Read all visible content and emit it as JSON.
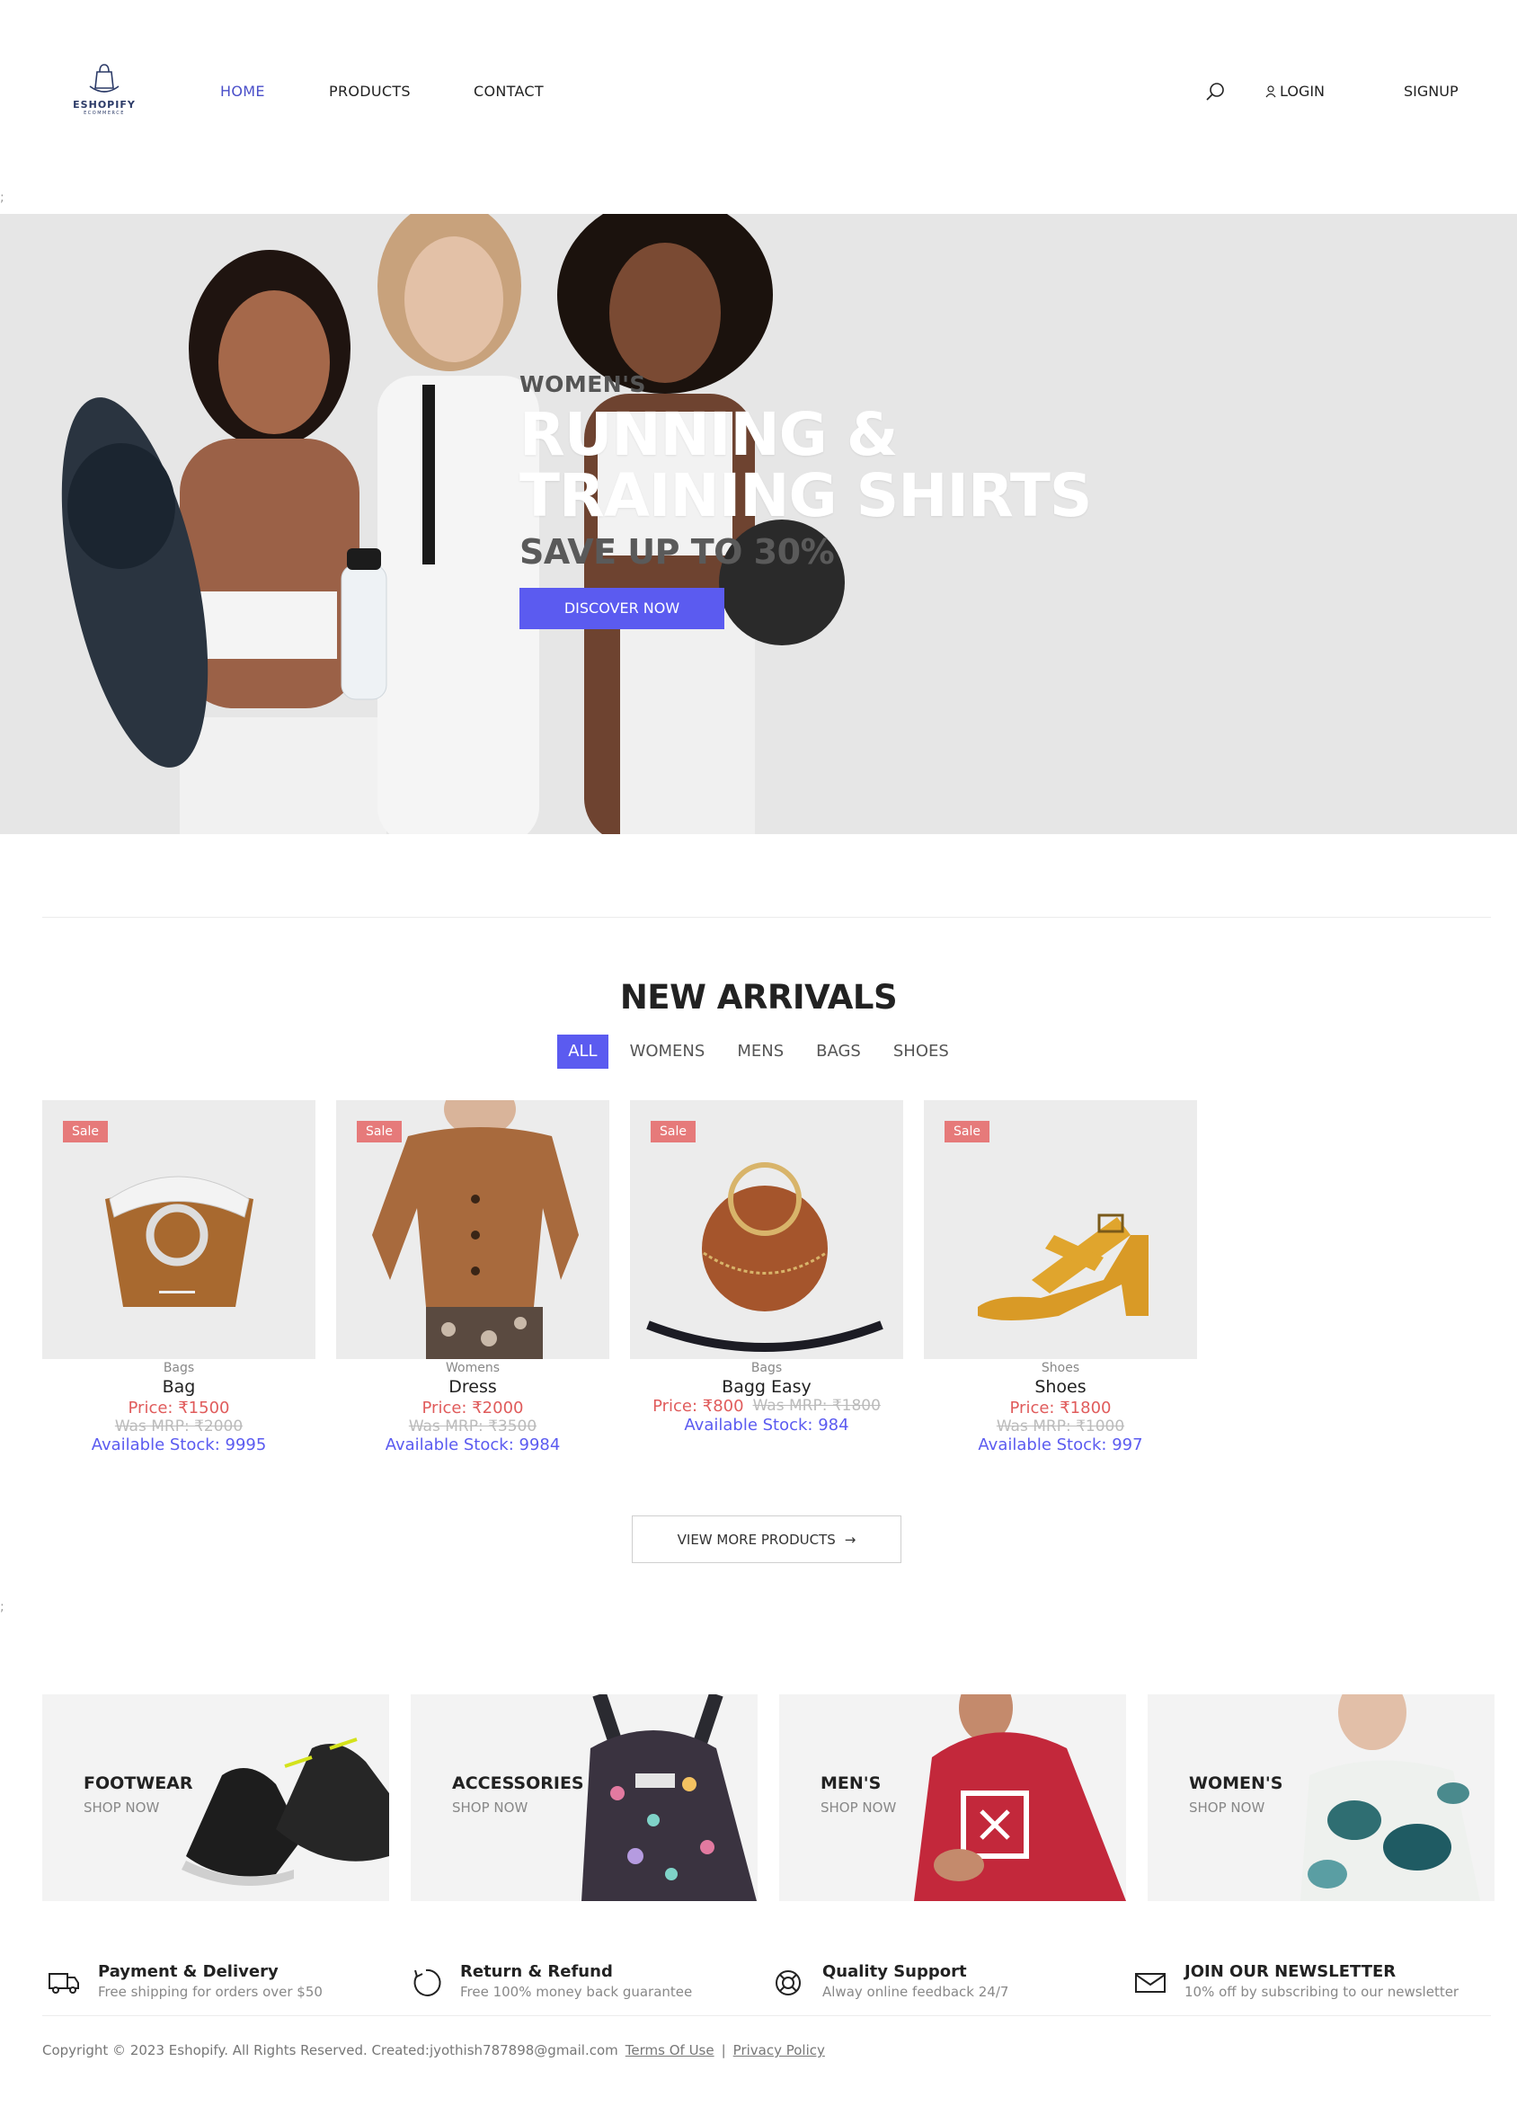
{
  "brand": {
    "name": "ESHOPIFY",
    "tagline": "ECOMMERCE"
  },
  "nav": {
    "links": [
      {
        "label": "HOME",
        "active": true
      },
      {
        "label": "PRODUCTS",
        "active": false
      },
      {
        "label": "CONTACT",
        "active": false
      }
    ],
    "login": "LOGIN",
    "signup": "SIGNUP",
    "search_icon": "search-icon",
    "user_icon": "user-icon"
  },
  "hero": {
    "pre_title": "WOMEN'S",
    "title_line1": "RUNNING &",
    "title_line2": "TRAINING SHIRTS",
    "subtitle": "SAVE UP TO 30%",
    "button": "DISCOVER NOW"
  },
  "new_arrivals": {
    "title": "NEW ARRIVALS",
    "filters": [
      "ALL",
      "WOMENS",
      "MENS",
      "BAGS",
      "SHOES"
    ],
    "active_filter": "ALL",
    "products": [
      {
        "badge": "Sale",
        "category": "Bags",
        "name": "Bag",
        "price": "Price: ₹1500",
        "was": "Was MRP: ₹2000",
        "stock": "Available Stock: 9995"
      },
      {
        "badge": "Sale",
        "category": "Womens",
        "name": "Dress",
        "price": "Price: ₹2000",
        "was": "Was MRP: ₹3500",
        "stock": "Available Stock: 9984"
      },
      {
        "badge": "Sale",
        "category": "Bags",
        "name": "Bagg Easy",
        "price": "Price: ₹800",
        "was": "Was MRP: ₹1800",
        "stock": "Available Stock: 984"
      },
      {
        "badge": "Sale",
        "category": "Shoes",
        "name": "Shoes",
        "price": "Price: ₹1800",
        "was": "Was MRP: ₹1000",
        "stock": "Available Stock: 997"
      }
    ],
    "view_more": "VIEW MORE PRODUCTS",
    "arrow": "→"
  },
  "categories": [
    {
      "title": "FOOTWEAR",
      "sub": "SHOP NOW"
    },
    {
      "title": "ACCESSORIES",
      "sub": "SHOP NOW"
    },
    {
      "title": "MEN'S",
      "sub": "SHOP NOW"
    },
    {
      "title": "WOMEN'S",
      "sub": "SHOP NOW"
    }
  ],
  "features": [
    {
      "icon": "truck-icon",
      "title": "Payment & Delivery",
      "sub": "Free shipping for orders over $50"
    },
    {
      "icon": "refund-icon",
      "title": "Return & Refund",
      "sub": "Free 100% money back guarantee"
    },
    {
      "icon": "support-icon",
      "title": "Quality Support",
      "sub": "Alway online feedback 24/7"
    },
    {
      "icon": "mail-icon",
      "title": "JOIN OUR NEWSLETTER",
      "sub": "10% off by subscribing to our newsletter"
    }
  ],
  "footer": {
    "copyright": "Copyright © 2023 Eshopify. All Rights Reserved. Created:jyothish787898@gmail.com",
    "terms": "Terms Of Use",
    "separator": "|",
    "privacy": "Privacy Policy"
  },
  "colors": {
    "accent": "#5b5bf0",
    "sale": "#e67a7a",
    "price": "#e05c5c",
    "nav_active": "#4a4fc9"
  }
}
